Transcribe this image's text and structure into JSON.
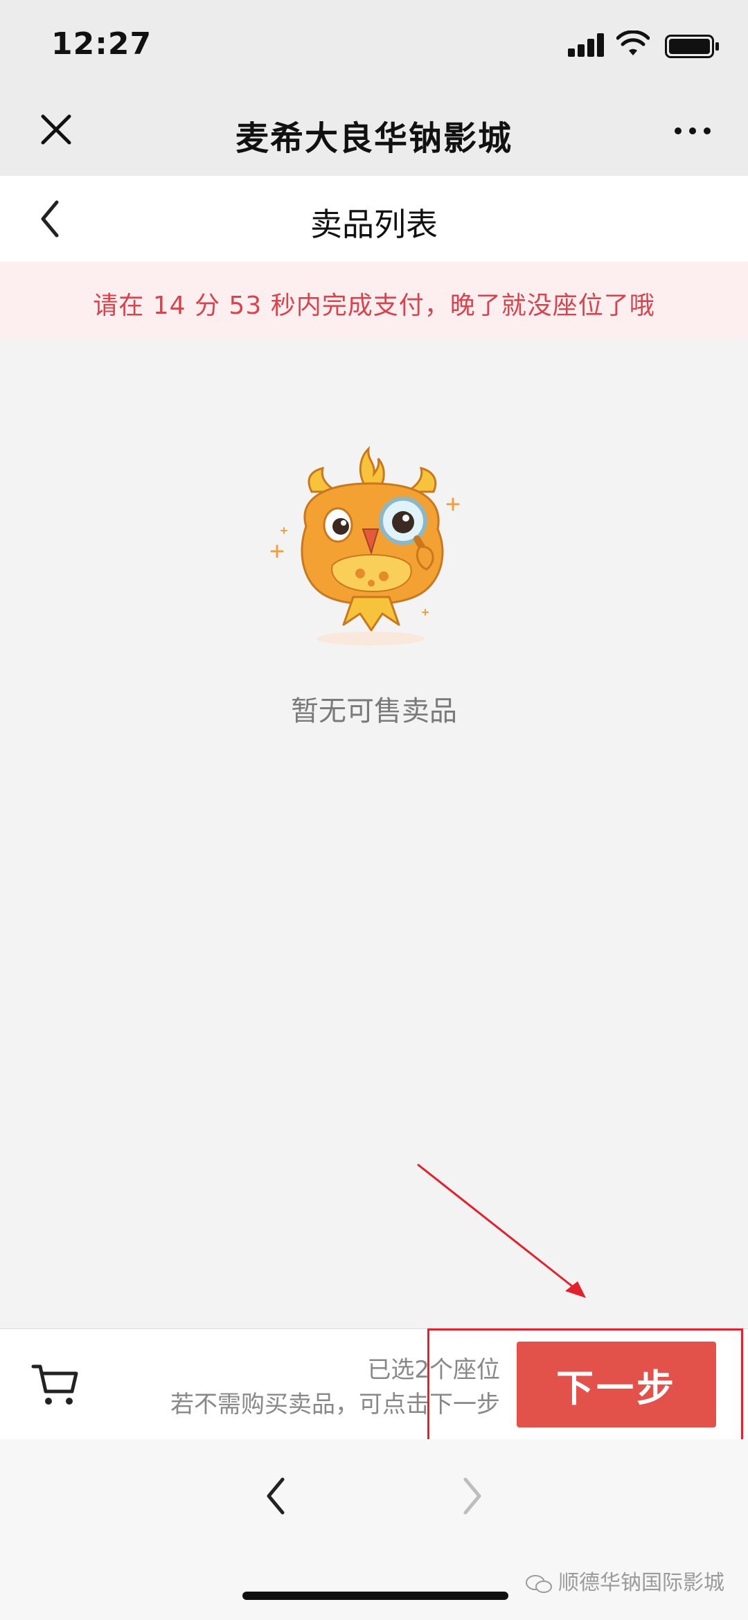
{
  "status_bar": {
    "time": "12:27"
  },
  "nav": {
    "title": "麦希大良华钠影城"
  },
  "page": {
    "title": "卖品列表"
  },
  "notice": {
    "text": "请在 14 分 53 秒内完成支付，晚了就没座位了哦"
  },
  "empty_state": {
    "text": "暂无可售卖品"
  },
  "cart_bar": {
    "selected_seats": "已选2个座位",
    "skip_hint": "若不需购买卖品，可点击下一步",
    "next_label": "下一步"
  },
  "watermark": {
    "text": "顺德华钠国际影城"
  },
  "colors": {
    "accent": "#e2524a",
    "notice_text": "#d9434e",
    "notice_bg": "#fdeeef",
    "annotation": "#e4202c"
  },
  "icons": {
    "close": "close-icon",
    "more": "more-icon",
    "back": "back-icon",
    "cart": "cart-icon",
    "browser_back": "chevron-left-icon",
    "browser_forward": "chevron-right-icon"
  }
}
